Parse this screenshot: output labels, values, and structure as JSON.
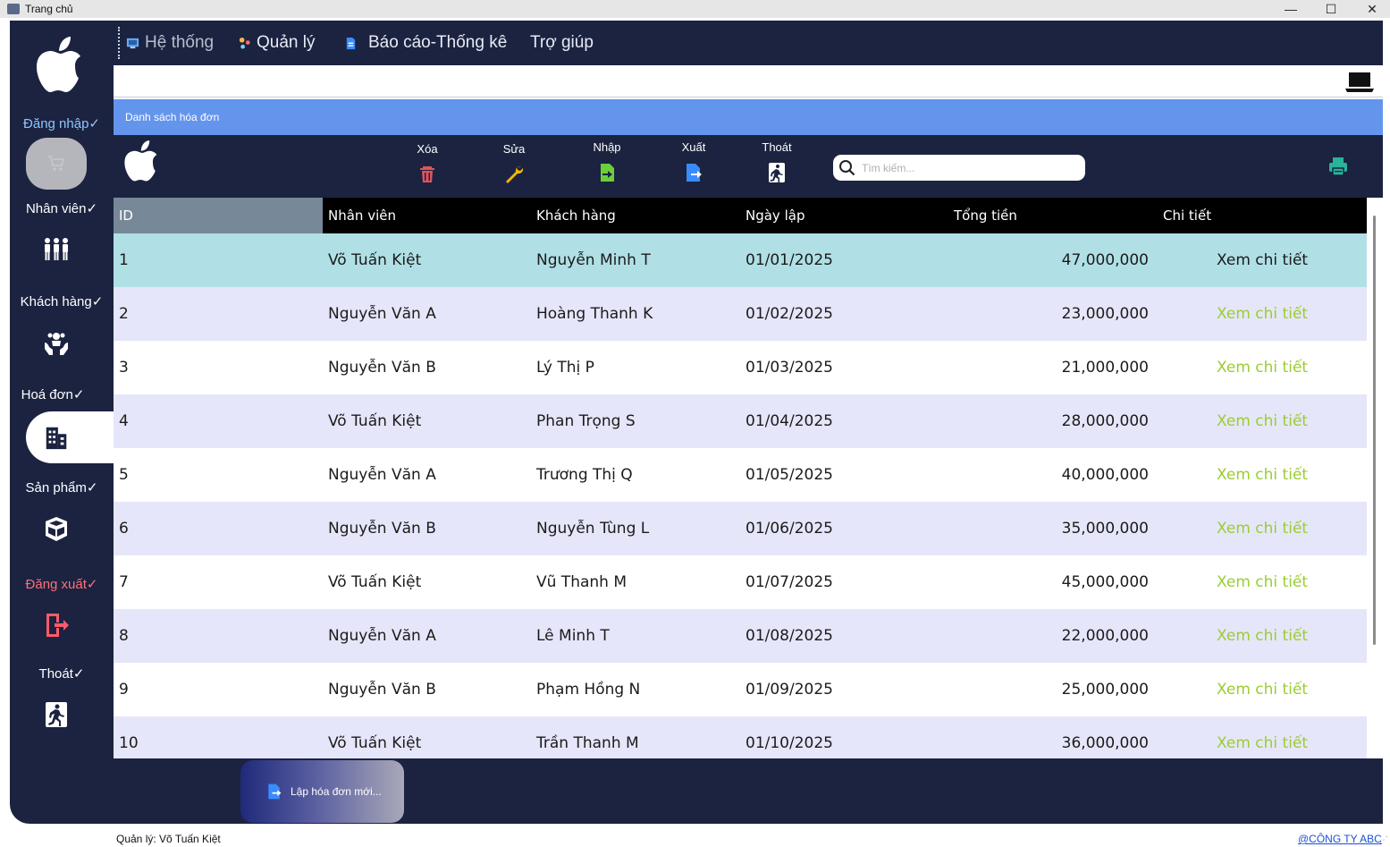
{
  "window": {
    "title": "Trang chủ",
    "minimize": "—",
    "maximize": "☐",
    "close": "✕"
  },
  "menu": [
    {
      "label": "Hệ thống"
    },
    {
      "label": "Quản lý"
    },
    {
      "label": "Báo cáo-Thống kê"
    },
    {
      "label": "Trợ giúp"
    }
  ],
  "sidebar": {
    "items": [
      {
        "label": "Đăng nhập✓",
        "icon": "cart-icon"
      },
      {
        "label": "Nhân viên✓",
        "icon": "people-icon"
      },
      {
        "label": "Khách hàng✓",
        "icon": "customer-icon"
      },
      {
        "label": "Hoá đơn✓",
        "icon": "building-icon"
      },
      {
        "label": "Sản phẩm✓",
        "icon": "box-icon"
      },
      {
        "label": "Đăng xuất✓",
        "icon": "logout-icon"
      },
      {
        "label": "Thoát✓",
        "icon": "exit-icon"
      }
    ]
  },
  "list_header": "Danh sách hóa đơn",
  "toolbar": {
    "delete_label": "Xóa",
    "edit_label": "Sửa",
    "import_label": "Nhập",
    "export_label": "Xuất",
    "exit_label": "Thoát"
  },
  "search": {
    "placeholder": "Tìm kiếm..."
  },
  "table": {
    "columns": [
      "ID",
      "Nhân viên",
      "Khách hàng",
      "Ngày lập",
      "Tổng tiền",
      "Chi tiết"
    ],
    "rows": [
      {
        "id": "1",
        "employee": "Võ Tuấn Kiệt",
        "customer": "Nguyễn Minh T",
        "date": "01/01/2025",
        "total": "47,000,000",
        "detail": "Xem chi tiết"
      },
      {
        "id": "2",
        "employee": "Nguyễn Văn A",
        "customer": "Hoàng Thanh K",
        "date": "01/02/2025",
        "total": "23,000,000",
        "detail": "Xem chi tiết"
      },
      {
        "id": "3",
        "employee": "Nguyễn Văn B",
        "customer": "Lý Thị P",
        "date": "01/03/2025",
        "total": "21,000,000",
        "detail": "Xem chi tiết"
      },
      {
        "id": "4",
        "employee": "Võ Tuấn Kiệt",
        "customer": "Phan Trọng S",
        "date": "01/04/2025",
        "total": "28,000,000",
        "detail": "Xem chi tiết"
      },
      {
        "id": "5",
        "employee": "Nguyễn Văn A",
        "customer": "Trương Thị Q",
        "date": "01/05/2025",
        "total": "40,000,000",
        "detail": "Xem chi tiết"
      },
      {
        "id": "6",
        "employee": "Nguyễn Văn B",
        "customer": "Nguyễn Tùng L",
        "date": "01/06/2025",
        "total": "35,000,000",
        "detail": "Xem chi tiết"
      },
      {
        "id": "7",
        "employee": "Võ Tuấn Kiệt",
        "customer": "Vũ Thanh M",
        "date": "01/07/2025",
        "total": "45,000,000",
        "detail": "Xem chi tiết"
      },
      {
        "id": "8",
        "employee": "Nguyễn Văn A",
        "customer": "Lê Minh T",
        "date": "01/08/2025",
        "total": "22,000,000",
        "detail": "Xem chi tiết"
      },
      {
        "id": "9",
        "employee": "Nguyễn Văn B",
        "customer": "Phạm Hồng N",
        "date": "01/09/2025",
        "total": "25,000,000",
        "detail": "Xem chi tiết"
      },
      {
        "id": "10",
        "employee": "Võ Tuấn Kiệt",
        "customer": "Trần Thanh M",
        "date": "01/10/2025",
        "total": "36,000,000",
        "detail": "Xem chi tiết"
      }
    ]
  },
  "new_invoice_button": "Lập hóa đơn mới...",
  "status": {
    "manager": "Quản lý: Võ Tuấn Kiệt",
    "company": "@CÔNG TY ABC"
  },
  "colors": {
    "navy": "#1b2340",
    "header_blue": "#6495ed",
    "selected_row": "#b0e0e6",
    "alt_row": "#e6e6fa",
    "link_green": "#9acd32"
  }
}
